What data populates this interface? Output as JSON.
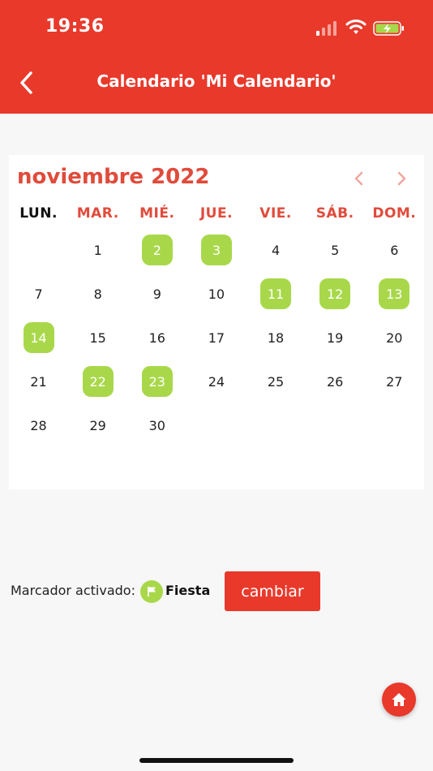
{
  "status": {
    "time": "19:36"
  },
  "header": {
    "title": "Calendario 'Mi Calendario'"
  },
  "calendar": {
    "month_title": "noviembre 2022",
    "weekdays": [
      "LUN.",
      "MAR.",
      "MIÉ.",
      "JUE.",
      "VIE.",
      "SÁB.",
      "DOM."
    ],
    "weeks": [
      [
        "",
        "1",
        "2",
        "3",
        "4",
        "5",
        "6"
      ],
      [
        "7",
        "8",
        "9",
        "10",
        "11",
        "12",
        "13"
      ],
      [
        "14",
        "15",
        "16",
        "17",
        "18",
        "19",
        "20"
      ],
      [
        "21",
        "22",
        "23",
        "24",
        "25",
        "26",
        "27"
      ],
      [
        "28",
        "29",
        "30",
        "",
        "",
        "",
        ""
      ]
    ],
    "marked_days": [
      "2",
      "3",
      "11",
      "12",
      "13",
      "14",
      "22",
      "23"
    ]
  },
  "marker": {
    "label": "Marcador activado:",
    "active_marker": "Fiesta",
    "change_label": "cambiar"
  },
  "colors": {
    "accent": "#e8392b",
    "month_text": "#e04b3b",
    "marked_day": "#a8d84a"
  },
  "icons": {
    "back": "chevron-left-icon",
    "prev": "chevron-left-icon",
    "next": "chevron-right-icon",
    "marker": "flag-icon",
    "home": "home-icon"
  }
}
